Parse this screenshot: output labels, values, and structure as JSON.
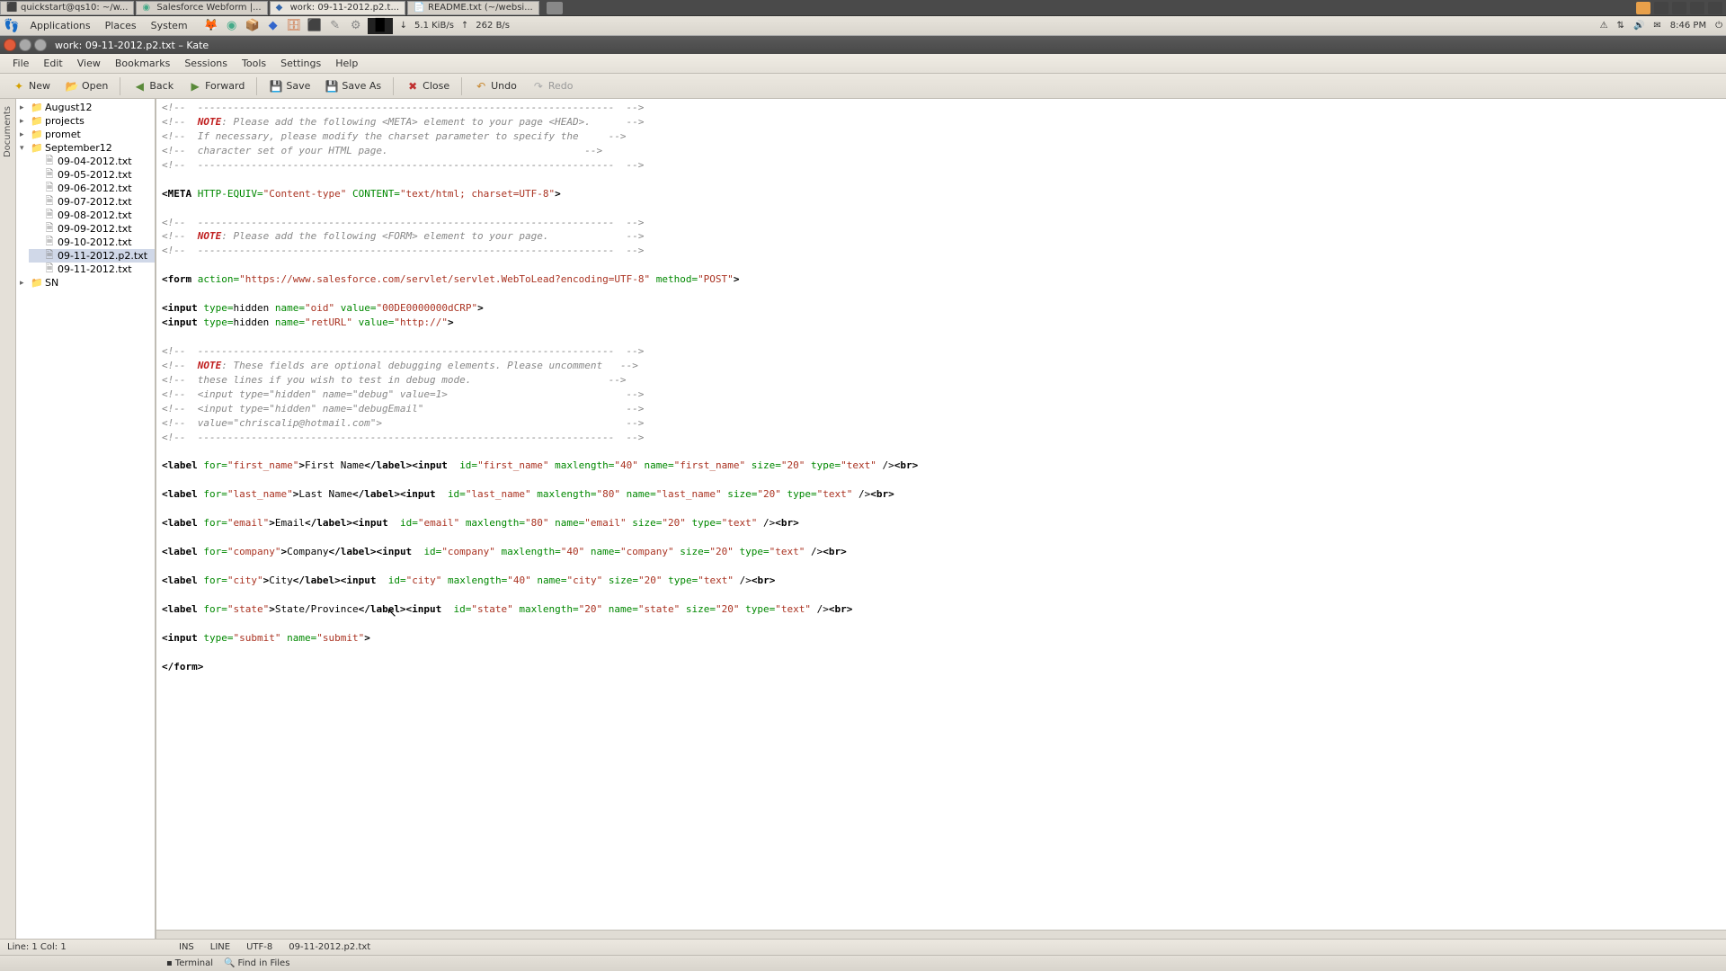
{
  "taskbar": {
    "tabs": [
      {
        "label": "quickstart@qs10: ~/w..."
      },
      {
        "label": "Salesforce Webform |..."
      },
      {
        "label": "work: 09-11-2012.p2.t..."
      },
      {
        "label": "README.txt (~/websi..."
      }
    ]
  },
  "gnome": {
    "applications": "Applications",
    "places": "Places",
    "system": "System",
    "net_down": "5.1 KiB/s",
    "net_up": "262 B/s",
    "time": "8:46 PM"
  },
  "window": {
    "title": "work: 09-11-2012.p2.txt – Kate"
  },
  "menubar": [
    "File",
    "Edit",
    "View",
    "Bookmarks",
    "Sessions",
    "Tools",
    "Settings",
    "Help"
  ],
  "toolbar": {
    "new": "New",
    "open": "Open",
    "back": "Back",
    "forward": "Forward",
    "save": "Save",
    "save_as": "Save As",
    "close": "Close",
    "undo": "Undo",
    "redo": "Redo"
  },
  "sidebar_label": "Documents",
  "tree": {
    "folders": [
      {
        "name": "August12",
        "expanded": false
      },
      {
        "name": "projects",
        "expanded": false
      },
      {
        "name": "promet",
        "expanded": false
      },
      {
        "name": "September12",
        "expanded": true,
        "children": [
          "09-04-2012.txt",
          "09-05-2012.txt",
          "09-06-2012.txt",
          "09-07-2012.txt",
          "09-08-2012.txt",
          "09-09-2012.txt",
          "09-10-2012.txt",
          "09-11-2012.p2.txt",
          "09-11-2012.txt"
        ],
        "selected": "09-11-2012.p2.txt"
      },
      {
        "name": "SN",
        "expanded": false
      }
    ]
  },
  "statusbar": {
    "line_col": "Line: 1 Col: 1",
    "ins": "INS",
    "mode": "LINE",
    "encoding": "UTF-8",
    "filename": "09-11-2012.p2.txt"
  },
  "bottom_tabs": {
    "terminal": "Terminal",
    "find": "Find in Files"
  },
  "code": {
    "dash_line": "----------------------------------------------------------------------",
    "note1": ": Please add the following <META> element to your page <HEAD>.",
    "note1b": "If necessary, please modify the charset parameter to specify the",
    "note1c": "character set of your HTML page.",
    "meta_httpequiv": "HTTP-EQUIV=",
    "meta_ct": "\"Content-type\"",
    "meta_content": "CONTENT=",
    "meta_val": "\"text/html; charset=UTF-8\"",
    "note2": ": Please add the following <FORM> element to your page.",
    "form_action": "action=",
    "form_url": "\"https://www.salesforce.com/servlet/servlet.WebToLead?encoding=UTF-8\"",
    "form_method": "method=",
    "form_post": "\"POST\"",
    "inp_hidden1": "<input type=hidden name=\"oid\" value=\"00DE0000000dCRP\">",
    "inp_hidden2": "<input type=hidden name=\"retURL\" value=\"http://\">",
    "note3a": ": These fields are optional debugging elements. Please uncomment",
    "note3b": "these lines if you wish to test in debug mode.",
    "note3c": "<input type=\"hidden\" name=\"debug\" value=1>",
    "note3d": "<input type=\"hidden\" name=\"debugEmail\"",
    "note3e": "value=\"chriscalip@hotmail.com\">",
    "fields": [
      {
        "for": "first_name",
        "lbl": "First Name",
        "maxlen": "40",
        "size": "20"
      },
      {
        "for": "last_name",
        "lbl": "Last Name",
        "maxlen": "80",
        "size": "20"
      },
      {
        "for": "email",
        "lbl": "Email",
        "maxlen": "80",
        "size": "20"
      },
      {
        "for": "company",
        "lbl": "Company",
        "maxlen": "40",
        "size": "20"
      },
      {
        "for": "city",
        "lbl": "City",
        "maxlen": "40",
        "size": "20"
      },
      {
        "for": "state",
        "lbl": "State/Province",
        "maxlen": "20",
        "size": "20"
      }
    ],
    "submit_line": "<input type=\"submit\" name=\"submit\">",
    "form_close": "</form>"
  }
}
